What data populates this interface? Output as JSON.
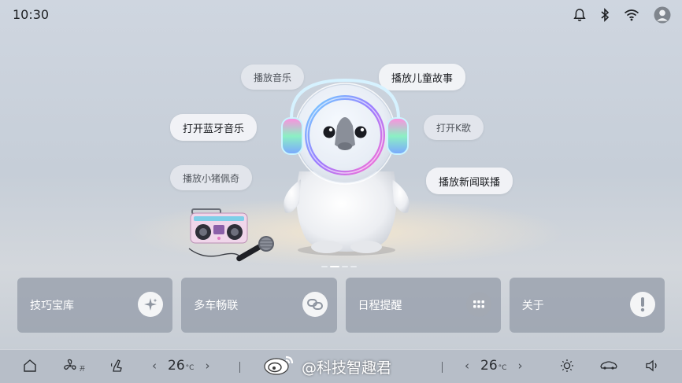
{
  "status_bar": {
    "time": "10:30",
    "icons": [
      "bell-icon",
      "bluetooth-icon",
      "wifi-icon",
      "account-icon"
    ]
  },
  "hero": {
    "suggestions": [
      {
        "label": "播放音乐",
        "style": "soft"
      },
      {
        "label": "播放儿童故事",
        "style": "strong"
      },
      {
        "label": "打开蓝牙音乐",
        "style": "strong"
      },
      {
        "label": "打开K歌",
        "style": "soft"
      },
      {
        "label": "播放小猪佩奇",
        "style": "soft"
      },
      {
        "label": "播放新闻联播",
        "style": "strong"
      }
    ],
    "carousel": {
      "pages": 4,
      "active_index": 1
    }
  },
  "cards": [
    {
      "label": "技巧宝库",
      "icon": "sparkle-icon"
    },
    {
      "label": "多车畅联",
      "icon": "link-icon"
    },
    {
      "label": "日程提醒",
      "icon": "grid-icon"
    },
    {
      "label": "关于",
      "icon": "info-icon"
    }
  ],
  "dock": {
    "left_temp": {
      "value": "26",
      "unit": "°C"
    },
    "right_temp": {
      "value": "26",
      "unit": "°C"
    },
    "fan_suffix": "开",
    "prev_symbol": "‹",
    "next_symbol": "›"
  },
  "watermark": {
    "text": "@科技智趣君"
  },
  "colors": {
    "accent_ring": "#8a7cff",
    "card_bg": "#969eaa",
    "dock_bg": "#b7bec8"
  }
}
